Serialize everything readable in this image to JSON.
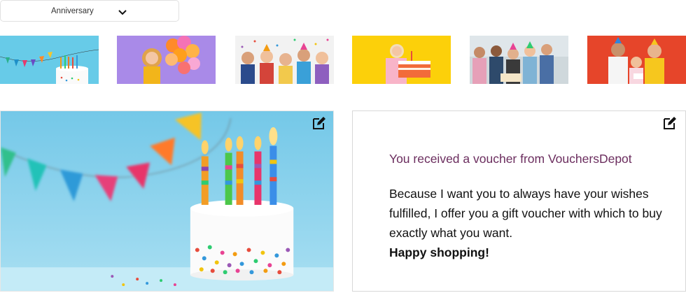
{
  "occasion_select": {
    "selected": "Anniversary",
    "icon": "chevron-down-icon"
  },
  "thumbnails": [
    {
      "name": "birthday-cake-pastel"
    },
    {
      "name": "girl-with-balloons"
    },
    {
      "name": "kids-party-confetti"
    },
    {
      "name": "woman-with-cake-yellow"
    },
    {
      "name": "friends-celebrating"
    },
    {
      "name": "family-celebrating-orange"
    }
  ],
  "preview": {
    "image": "birthday-cake-with-candles",
    "edit_icon": "edit-icon"
  },
  "message": {
    "title": "You received a voucher from VouchersDepot",
    "body": "Because I want you to always have your wishes fulfilled, I offer you a gift voucher with which to buy exactly what you want.",
    "closing": "Happy shopping!",
    "edit_icon": "edit-icon"
  },
  "colors": {
    "accent": "#6b2d5e",
    "border": "#d8d8d8"
  }
}
